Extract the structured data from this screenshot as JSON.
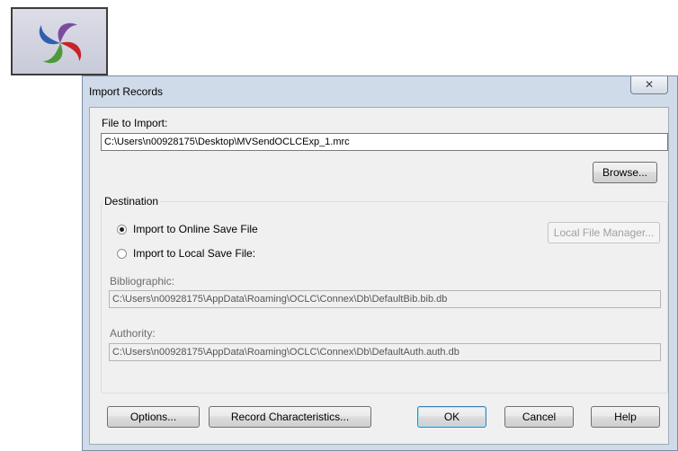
{
  "dialog": {
    "title": "Import Records",
    "close_glyph": "✕",
    "file_label": "File to Import:",
    "file_value": "C:\\Users\\n00928175\\Desktop\\MVSendOCLCExp_1.mrc",
    "browse_label": "Browse...",
    "destination_label": "Destination",
    "radio_online_label": "Import to Online Save File",
    "radio_local_label": "Import to Local Save File:",
    "radio_selected": "online",
    "local_file_manager_label": "Local File Manager...",
    "bibliographic_label": "Bibliographic:",
    "bibliographic_value": "C:\\Users\\n00928175\\AppData\\Roaming\\OCLC\\Connex\\Db\\DefaultBib.bib.db",
    "authority_label": "Authority:",
    "authority_value": "C:\\Users\\n00928175\\AppData\\Roaming\\OCLC\\Connex\\Db\\DefaultAuth.auth.db",
    "buttons": {
      "options": "Options...",
      "record_characteristics": "Record Characteristics...",
      "ok": "OK",
      "cancel": "Cancel",
      "help": "Help"
    }
  },
  "icons": {
    "app": "oclc-connexion-app-icon",
    "close": "close-icon"
  },
  "colors": {
    "window_frame": "#cfdbe8",
    "dialog_body": "#f0f0f0",
    "logo_red": "#c8222b",
    "logo_blue": "#2f5fae",
    "logo_green": "#4c9a3a",
    "logo_purple": "#7a4c9e"
  }
}
